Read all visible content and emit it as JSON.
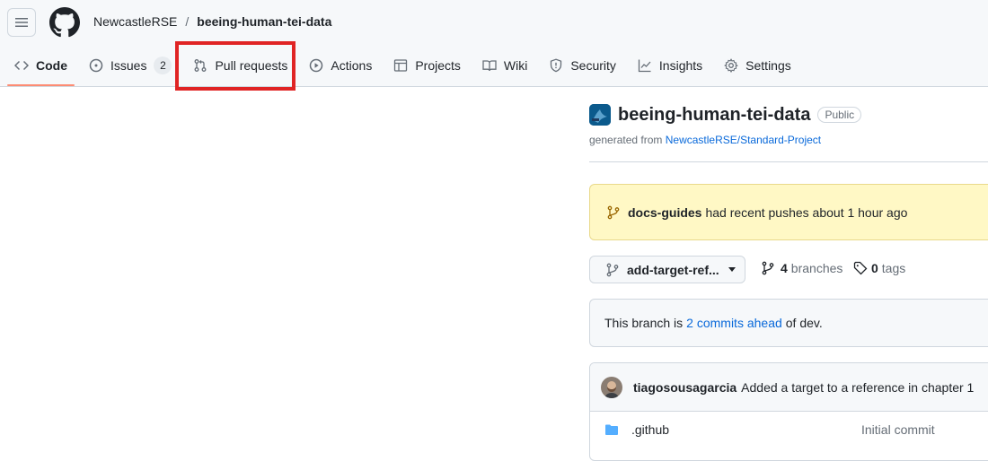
{
  "header": {
    "owner": "NewcastleRSE",
    "separator": "/",
    "repo": "beeing-human-tei-data"
  },
  "nav": {
    "tabs": [
      {
        "label": "Code",
        "icon": "code-icon",
        "selected": true
      },
      {
        "label": "Issues",
        "icon": "issue-opened-icon",
        "count": "2"
      },
      {
        "label": "Pull requests",
        "icon": "git-pull-request-icon"
      },
      {
        "label": "Actions",
        "icon": "play-icon"
      },
      {
        "label": "Projects",
        "icon": "table-icon"
      },
      {
        "label": "Wiki",
        "icon": "book-icon"
      },
      {
        "label": "Security",
        "icon": "shield-icon"
      },
      {
        "label": "Insights",
        "icon": "graph-icon"
      },
      {
        "label": "Settings",
        "icon": "gear-icon"
      }
    ],
    "highlight_color": "#e02424"
  },
  "repo": {
    "name": "beeing-human-tei-data",
    "visibility": "Public",
    "generated_prefix": "generated from",
    "template": "NewcastleRSE/Standard-Project"
  },
  "flash": {
    "branch": "docs-guides",
    "message": "had recent pushes about 1 hour ago"
  },
  "branch_bar": {
    "current_branch": "add-target-ref...",
    "branches_count": "4",
    "branches_label": "branches",
    "tags_count": "0",
    "tags_label": "tags"
  },
  "ahead": {
    "prefix": "This branch is",
    "link": "2 commits ahead",
    "suffix": "of dev."
  },
  "latest_commit": {
    "author": "tiagosousagarcia",
    "message": "Added a target to a reference in chapter 1"
  },
  "files": [
    {
      "name": ".github",
      "type": "folder",
      "message": "Initial commit"
    }
  ],
  "colors": {
    "accent": "#0969da",
    "tab_underline": "#fd8c73",
    "flash_bg": "#fff8c5",
    "folder": "#54aeff"
  }
}
